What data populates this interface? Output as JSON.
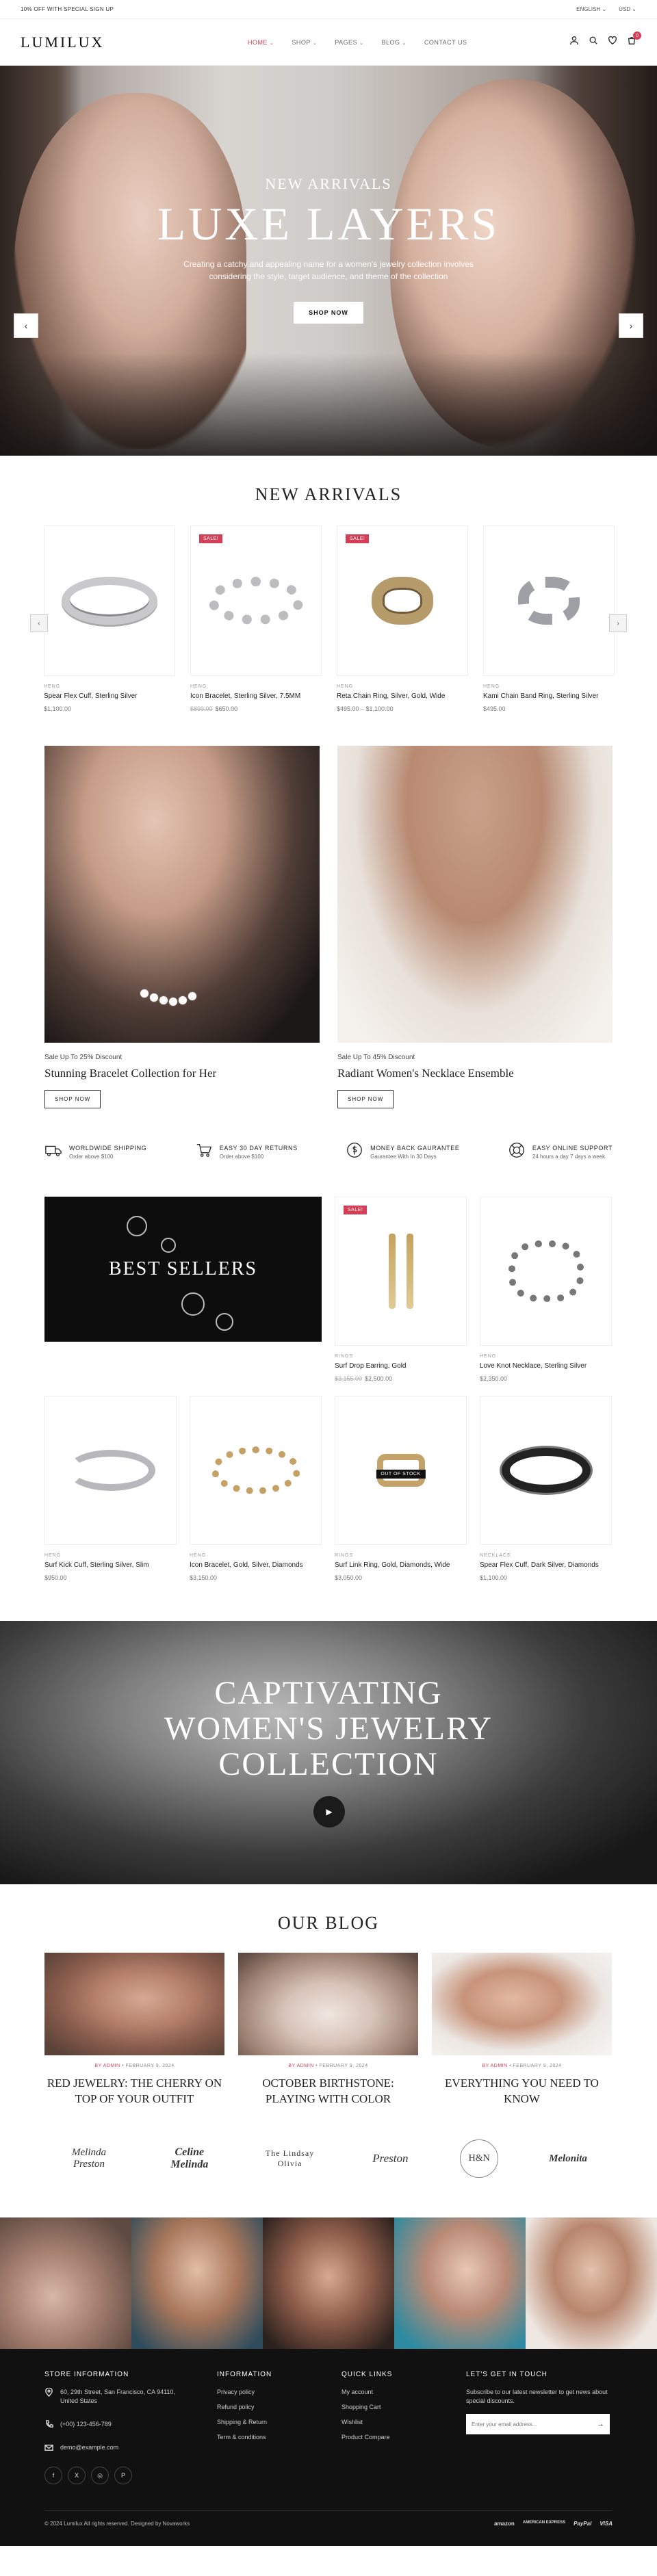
{
  "topbar": {
    "promo": "10% OFF WITH SPECIAL SIGN UP",
    "language": "ENGLISH",
    "currency": "USD"
  },
  "header": {
    "logo": "LUMILUX",
    "nav": [
      "HOME",
      "SHOP",
      "PAGES",
      "BLOG",
      "CONTACT US"
    ],
    "cart_count": "0"
  },
  "hero": {
    "kicker": "NEW ARRIVALS",
    "title": "LUXE LAYERS",
    "text": "Creating a catchy and appealing name for a women's jewelry collection involves considering the style, target audience, and theme of the collection",
    "button": "SHOP NOW"
  },
  "arrivals": {
    "title": "NEW ARRIVALS",
    "products": [
      {
        "brand": "HENG",
        "name": "Spear Flex Cuff, Sterling Silver",
        "price": "$1,100.00",
        "old_price": "",
        "sale": ""
      },
      {
        "brand": "HENG",
        "name": "Icon Bracelet, Sterling Silver, 7.5MM",
        "price": "$650.00",
        "old_price": "$899.00",
        "sale": "SALE!"
      },
      {
        "brand": "HENG",
        "name": "Reta Chain Ring, Silver, Gold, Wide",
        "price": "$495.00 – $1,100.00",
        "old_price": "",
        "sale": "SALE!"
      },
      {
        "brand": "HENG",
        "name": "Kami Chain Band Ring, Sterling Silver",
        "price": "$495.00",
        "old_price": "",
        "sale": ""
      }
    ]
  },
  "promos": [
    {
      "caption": "Sale Up To 25% Discount",
      "title": "Stunning Bracelet Collection for Her",
      "button": "SHOP NOW"
    },
    {
      "caption": "Sale Up To 45% Discount",
      "title": "Radiant Women's Necklace Ensemble",
      "button": "SHOP NOW"
    }
  ],
  "features": [
    {
      "title": "WORLDWIDE SHIPPING",
      "sub": "Order above $100"
    },
    {
      "title": "EASY 30 DAY RETURNS",
      "sub": "Order above $100"
    },
    {
      "title": "MONEY BACK GAURANTEE",
      "sub": "Gaurantee With In 30 Days"
    },
    {
      "title": "EASY ONLINE SUPPORT",
      "sub": "24 hours a day 7 days a week"
    }
  ],
  "bestsellers": {
    "banner": "BEST SELLERS",
    "products": [
      {
        "brand": "RINGS",
        "name": "Surf Drop Earring, Gold",
        "price": "$2,500.00",
        "old_price": "$3,155.00",
        "sale": "SALE!",
        "badge": ""
      },
      {
        "brand": "HENG",
        "name": "Love Knot Necklace, Sterling Silver",
        "price": "$2,350.00",
        "old_price": "",
        "sale": "",
        "badge": ""
      },
      {
        "brand": "HENG",
        "name": "Surf Kick Cuff, Sterling Silver, Slim",
        "price": "$950.00",
        "old_price": "",
        "sale": "",
        "badge": ""
      },
      {
        "brand": "HENG",
        "name": "Icon Bracelet, Gold, Silver, Diamonds",
        "price": "$3,150.00",
        "old_price": "",
        "sale": "",
        "badge": ""
      },
      {
        "brand": "RINGS",
        "name": "Surf Link Ring, Gold, Diamonds, Wide",
        "price": "$3,050.00",
        "old_price": "",
        "sale": "",
        "badge": "OUT OF STOCK"
      },
      {
        "brand": "NECKLACE",
        "name": "Spear Flex Cuff, Dark Silver, Diamonds",
        "price": "$1,100.00",
        "old_price": "",
        "sale": "",
        "badge": ""
      }
    ]
  },
  "video": {
    "line1": "CAPTIVATING",
    "line2": "WOMEN'S JEWELRY",
    "line3": "COLLECTION"
  },
  "blog": {
    "title": "OUR BLOG",
    "posts": [
      {
        "author": "BY ADMIN",
        "date": "FEBRUARY 9, 2024",
        "title": "RED JEWELRY: THE CHERRY ON TOP OF YOUR OUTFIT"
      },
      {
        "author": "BY ADMIN",
        "date": "FEBRUARY 9, 2024",
        "title": "OCTOBER BIRTHSTONE: PLAYING WITH COLOR"
      },
      {
        "author": "BY ADMIN",
        "date": "FEBRUARY 9, 2024",
        "title": "EVERYTHING YOU NEED TO KNOW"
      }
    ]
  },
  "brands": [
    "Melinda Preston",
    "Celine Melinda",
    "The Lindsay Olivia",
    "Preston",
    "H&N",
    "Melonita"
  ],
  "footer": {
    "store": {
      "title": "STORE INFORMATION",
      "address": "60, 29th Street, San Francisco, CA 94110, United States",
      "phone": "(+00) 123-456-789",
      "email": "demo@example.com"
    },
    "info": {
      "title": "INFORMATION",
      "links": [
        "Privacy policy",
        "Refund policy",
        "Shipping & Return",
        "Term & conditions"
      ]
    },
    "quick": {
      "title": "QUICK LINKS",
      "links": [
        "My account",
        "Shopping Cart",
        "Wishlist",
        "Product Compare"
      ]
    },
    "newsletter": {
      "title": "LET'S GET IN TOUCH",
      "text": "Subscribe to our latest newsletter to get news about special discounts.",
      "placeholder": "Enter your email address..."
    },
    "social": [
      "f",
      "X",
      "◎",
      "P"
    ],
    "copyright": "© 2024 Lumilux All rights reserved. Designed by Novaworks",
    "payments": [
      "amazon",
      "AMERICAN EXPRESS",
      "PayPal",
      "VISA"
    ]
  }
}
